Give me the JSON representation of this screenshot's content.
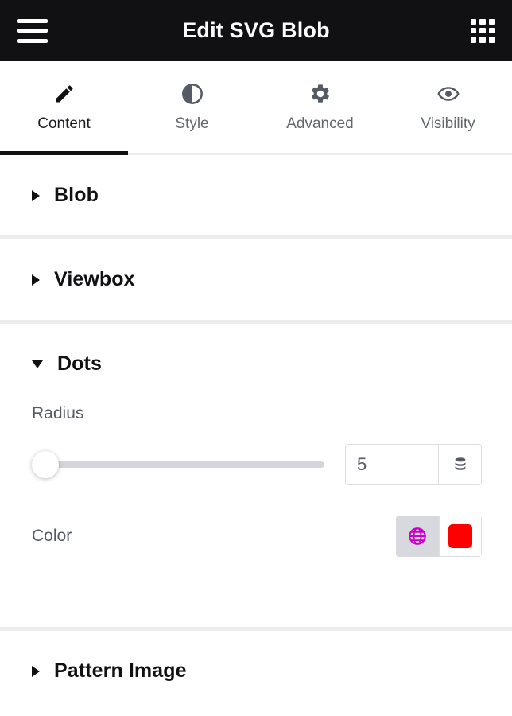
{
  "header": {
    "title": "Edit SVG Blob",
    "menu_icon": "hamburger-menu-icon",
    "apps_icon": "apps-grid-icon",
    "background": "#111113"
  },
  "tabs": [
    {
      "label": "Content",
      "icon": "pencil-icon",
      "active": true
    },
    {
      "label": "Style",
      "icon": "contrast-icon",
      "active": false
    },
    {
      "label": "Advanced",
      "icon": "gear-icon",
      "active": false
    },
    {
      "label": "Visibility",
      "icon": "eye-icon",
      "active": false
    }
  ],
  "sections": [
    {
      "title": "Blob",
      "expanded": false
    },
    {
      "title": "Viewbox",
      "expanded": false
    },
    {
      "title": "Dots",
      "expanded": true
    },
    {
      "title": "Pattern Image",
      "expanded": false
    }
  ],
  "dots": {
    "radius": {
      "label": "Radius",
      "value": "5",
      "placeholder": "",
      "slider_position_percent": 0,
      "unit_icon": "database-stack-icon"
    },
    "color": {
      "label": "Color",
      "global_icon": "globe-icon",
      "global_icon_color": "#cc00cc",
      "swatch_color": "#ff0000"
    }
  },
  "colors": {
    "accent_dark": "#111113",
    "label_gray": "#555a64",
    "divider": "#ebecee",
    "track": "#d4d6db"
  }
}
